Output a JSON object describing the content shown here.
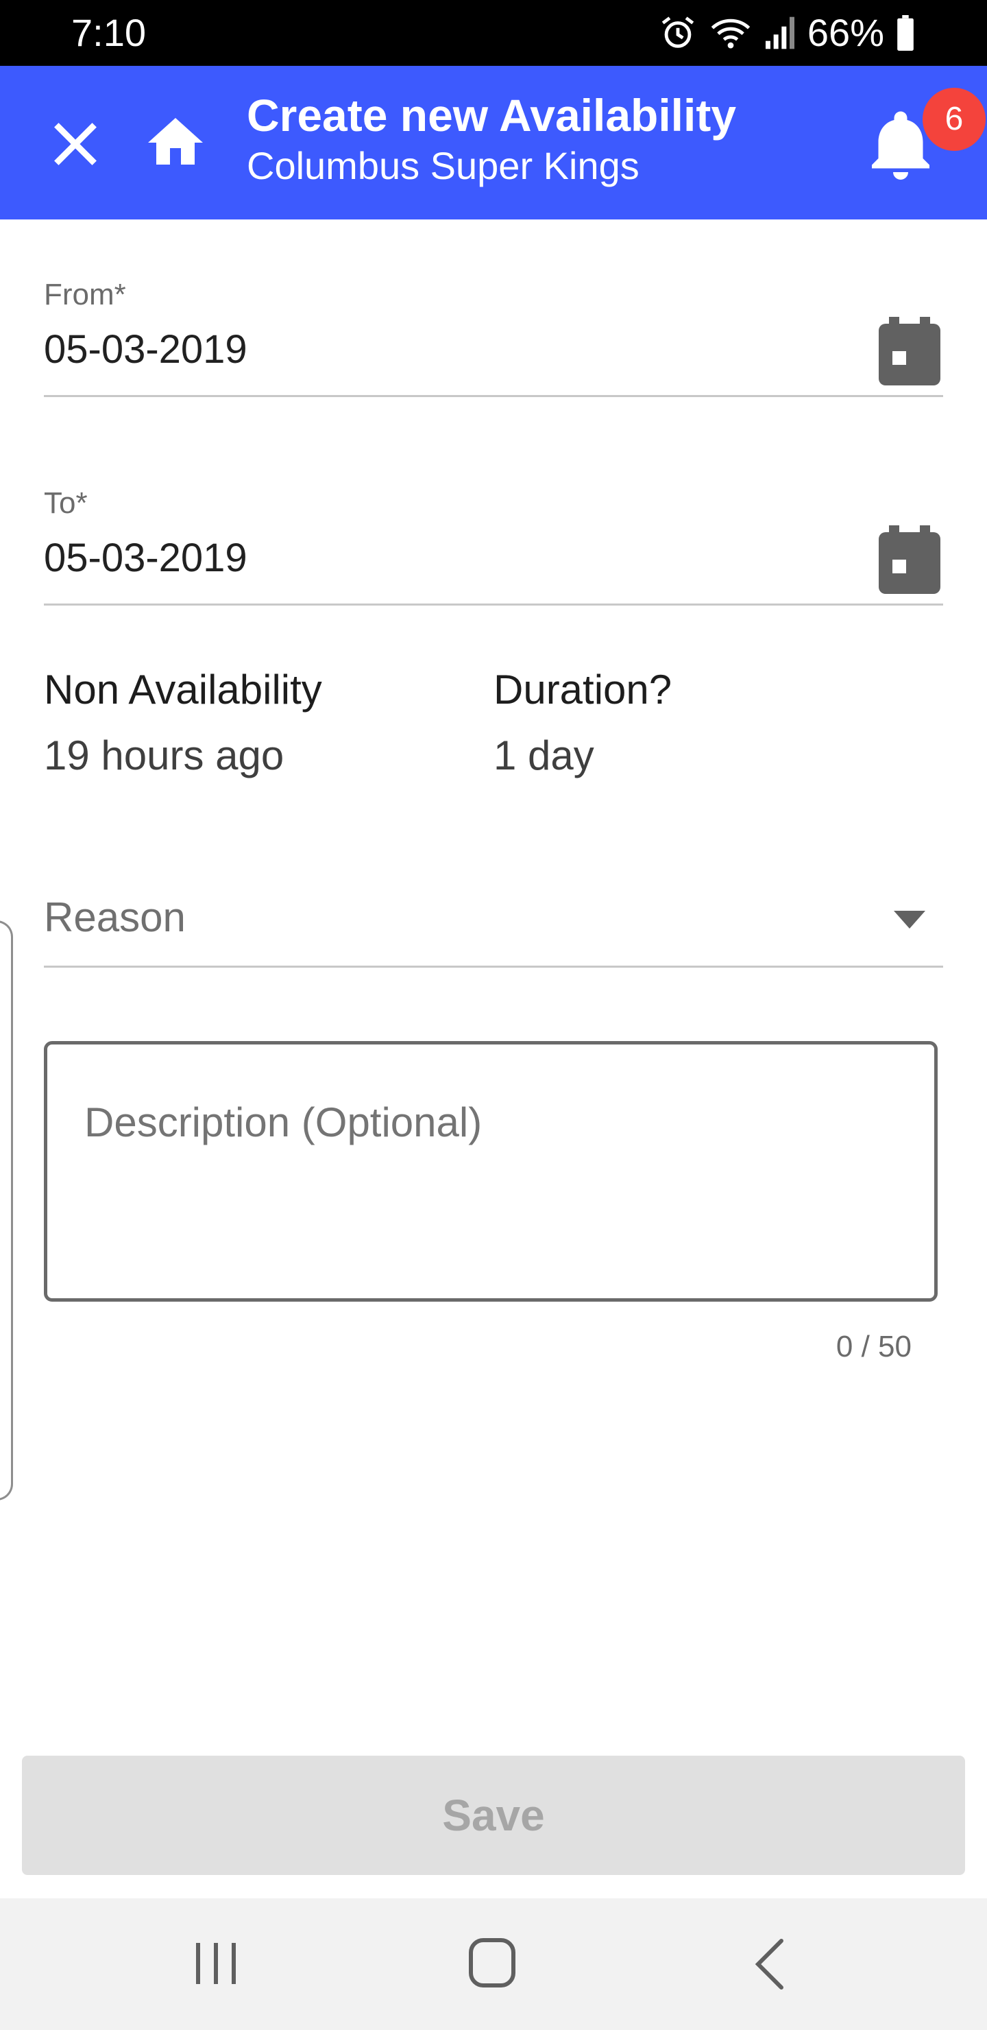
{
  "status_bar": {
    "time": "7:10",
    "battery": "66%"
  },
  "app_bar": {
    "title": "Create new Availability",
    "subtitle": "Columbus Super Kings",
    "notification_count": "6",
    "color": "#3d5afe"
  },
  "form": {
    "from": {
      "label": "From*",
      "value": "05-03-2019"
    },
    "to": {
      "label": "To*",
      "value": "05-03-2019"
    },
    "non_availability": {
      "label": "Non Availability",
      "value": "19 hours ago"
    },
    "duration": {
      "label": "Duration?",
      "value": "1 day"
    },
    "reason": {
      "placeholder": "Reason"
    },
    "description": {
      "placeholder": "Description (Optional)",
      "counter": "0 / 50"
    }
  },
  "actions": {
    "save_label": "Save"
  },
  "icons": {
    "close": "close-icon",
    "home": "home-icon",
    "bell": "bell-icon",
    "calendar": "calendar-icon",
    "dropdown": "chevron-down-icon"
  }
}
